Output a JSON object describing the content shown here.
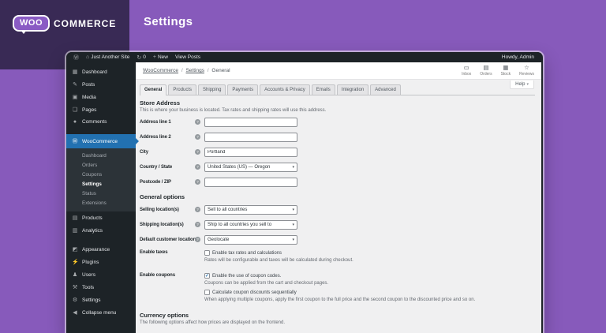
{
  "colors": {
    "brand_purple": "#875abb",
    "dark_purple": "#392a55",
    "admin_dark": "#1d2327",
    "active_blue": "#2271b1"
  },
  "banner": {
    "logo_woo": "WOO",
    "logo_commerce": "COMMERCE",
    "title": "Settings"
  },
  "admin_bar": {
    "wp_glyph": "Ⓦ",
    "home_glyph": "⌂",
    "site_name": "Just Another Site",
    "update_glyph": "↻",
    "update_count": "0",
    "new_glyph": "+",
    "new_label": "New",
    "view_posts": "View Posts",
    "howdy": "Howdy, Admin"
  },
  "sidebar": {
    "items_top": [
      {
        "glyph": "▦",
        "label": "Dashboard"
      },
      {
        "glyph": "✎",
        "label": "Posts"
      },
      {
        "glyph": "▣",
        "label": "Media"
      },
      {
        "glyph": "❏",
        "label": "Pages"
      },
      {
        "glyph": "●",
        "label": "Comments"
      }
    ],
    "woocommerce": {
      "glyph": "Ⓦ",
      "label": "WooCommerce"
    },
    "submenu": [
      "Dashboard",
      "Orders",
      "Coupons",
      "Settings",
      "Status",
      "Extensions"
    ],
    "items_mid": [
      {
        "glyph": "▤",
        "label": "Products"
      },
      {
        "glyph": "▥",
        "label": "Analytics"
      }
    ],
    "items_bottom": [
      {
        "glyph": "◩",
        "label": "Appearance"
      },
      {
        "glyph": "⚡",
        "label": "Plugins"
      },
      {
        "glyph": "♟",
        "label": "Users"
      },
      {
        "glyph": "⚒",
        "label": "Tools"
      },
      {
        "glyph": "⚙",
        "label": "Settings"
      },
      {
        "glyph": "◀",
        "label": "Collapse menu"
      }
    ]
  },
  "header": {
    "breadcrumb": {
      "part1": "WooCommerce",
      "sep": "/",
      "part2": "Settings",
      "part3": "General"
    },
    "activity": [
      {
        "glyph": "▭",
        "label": "Inbox"
      },
      {
        "glyph": "▤",
        "label": "Orders"
      },
      {
        "glyph": "▦",
        "label": "Stock"
      },
      {
        "glyph": "☆",
        "label": "Reviews"
      }
    ],
    "help": {
      "label": "Help",
      "chevron": "▾"
    }
  },
  "tabs": [
    {
      "label": "General",
      "active": true
    },
    {
      "label": "Products",
      "active": false
    },
    {
      "label": "Shipping",
      "active": false
    },
    {
      "label": "Payments",
      "active": false
    },
    {
      "label": "Accounts & Privacy",
      "active": false
    },
    {
      "label": "Emails",
      "active": false
    },
    {
      "label": "Integration",
      "active": false
    },
    {
      "label": "Advanced",
      "active": false
    }
  ],
  "icons": {
    "help_glyph": "?",
    "check_glyph": "✓",
    "select_chevron": "▾"
  },
  "store_address": {
    "title": "Store Address",
    "description": "This is where your business is located. Tax rates and shipping rates will use this address.",
    "fields": [
      {
        "label": "Address line 1",
        "value": ""
      },
      {
        "label": "Address line 2",
        "value": ""
      },
      {
        "label": "City",
        "value": "Portland"
      },
      {
        "label": "Country / State",
        "value": "United States (US) — Oregon"
      },
      {
        "label": "Postcode / ZIP",
        "value": ""
      }
    ]
  },
  "general_options": {
    "title": "General options",
    "selects": [
      {
        "label": "Selling location(s)",
        "value": "Sell to all countries"
      },
      {
        "label": "Shipping location(s)",
        "value": "Ship to all countries you sell to"
      },
      {
        "label": "Default customer location",
        "value": "Geolocate"
      }
    ],
    "taxes": {
      "label": "Enable taxes",
      "checkbox": "Enable tax rates and calculations",
      "note": "Rates will be configurable and taxes will be calculated during checkout."
    },
    "coupons": {
      "label": "Enable coupons",
      "checkbox1": "Enable the use of coupon codes.",
      "note1": "Coupons can be applied from the cart and checkout pages.",
      "checkbox2": "Calculate coupon discounts sequentially",
      "note2": "When applying multiple coupons, apply the first coupon to the full price and the second coupon to the discounted price and so on."
    }
  },
  "currency_options": {
    "title": "Currency options",
    "description": "The following options affect how prices are displayed on the frontend."
  }
}
